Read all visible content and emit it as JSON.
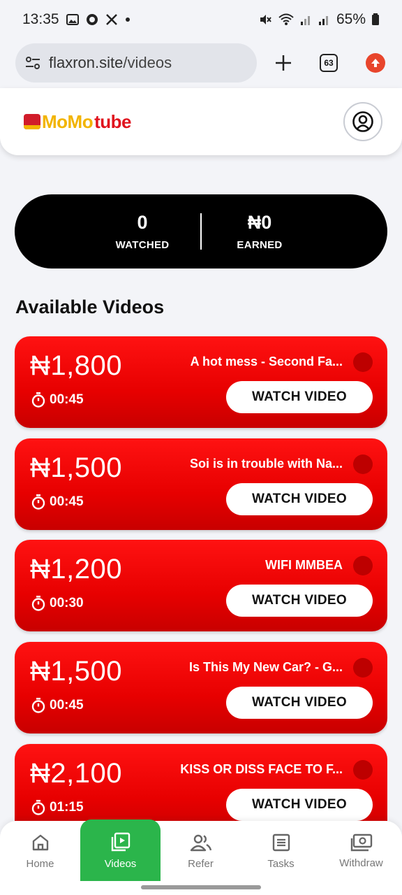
{
  "status_bar": {
    "time": "13:35",
    "left_icons": [
      "gallery-icon",
      "app-icon",
      "x-icon",
      "dot"
    ],
    "right_icons": [
      "mute-icon",
      "wifi-icon",
      "signal-icon",
      "signal-icon-2",
      "battery-icon"
    ],
    "battery": "65%"
  },
  "browser": {
    "url_domain": "flaxron.site",
    "url_path": "/videos",
    "tab_count": "63"
  },
  "header": {
    "logo_part_1": "MoMo",
    "logo_part_2": "tube"
  },
  "stats": {
    "watched_value": "0",
    "watched_label": "WATCHED",
    "earned_value": "₦0",
    "earned_label": "EARNED"
  },
  "section_title": "Available Videos",
  "videos": [
    {
      "price": "₦1,800",
      "duration": "00:45",
      "title": "A hot mess - Second Fa...",
      "button": "WATCH VIDEO"
    },
    {
      "price": "₦1,500",
      "duration": "00:45",
      "title": "Soi is in trouble with Na...",
      "button": "WATCH VIDEO"
    },
    {
      "price": "₦1,200",
      "duration": "00:30",
      "title": "WIFI MMBEA",
      "button": "WATCH VIDEO"
    },
    {
      "price": "₦1,500",
      "duration": "00:45",
      "title": "Is This My New Car? - G...",
      "button": "WATCH VIDEO"
    },
    {
      "price": "₦2,100",
      "duration": "01:15",
      "title": "KISS OR DISS FACE TO F...",
      "button": "WATCH VIDEO"
    }
  ],
  "nav": [
    {
      "label": "Home",
      "icon": "home-icon",
      "active": false
    },
    {
      "label": "Videos",
      "icon": "video-icon",
      "active": true
    },
    {
      "label": "Refer",
      "icon": "users-icon",
      "active": false
    },
    {
      "label": "Tasks",
      "icon": "tasks-icon",
      "active": false
    },
    {
      "label": "Withdraw",
      "icon": "money-icon",
      "active": false
    }
  ],
  "colors": {
    "card_red": "#e70000",
    "nav_active": "#2bb54b",
    "stats_bg": "#000000",
    "logo_yellow": "#f2b400",
    "logo_red": "#e0141e"
  }
}
